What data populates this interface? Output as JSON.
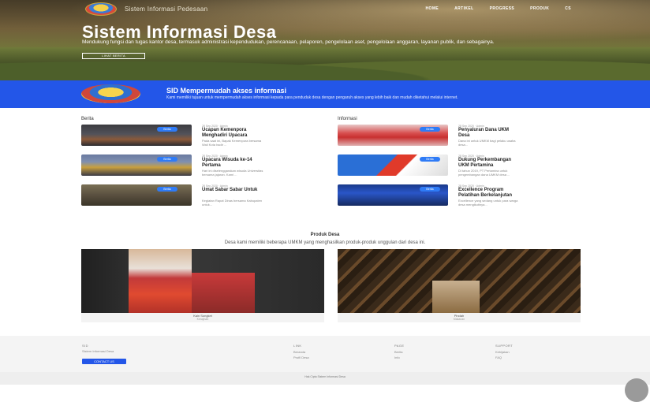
{
  "header": {
    "site_name": "Sistem Informasi Pedesaan",
    "nav": [
      "HOME",
      "ARTIKEL",
      "PROGRESS",
      "PRODUK",
      "CS"
    ]
  },
  "hero": {
    "title": "Sistem Informasi Desa",
    "description": "Mendukung fungsi dan tugas kantor desa, termasuk administrasi kependudukan, perencanaan, pelaporen, pengelolaan aset, pengelolaan anggaran, layanan publik, dan sebagainya.",
    "button": "LIHAT BERITA"
  },
  "band": {
    "title": "SID Mempermudah akses informasi",
    "description": "Kami memiliki tujuan untuk mempermudah akses informasi kepada para penduduk desa dengan pengaruh akses yang lebih baik dan mudah diketahui melalui internet."
  },
  "berita": {
    "heading": "Berita",
    "items": [
      {
        "badge": "Berita",
        "meta": "28 Sep 2020  ·  Admin",
        "title": "Ucapan Kemenpora Menghadiri Upacara",
        "excerpt": "Pada saat ini, Bapak Kemenpora bersama Wali Kota hadir ..."
      },
      {
        "badge": "Berita",
        "meta": "28 Sep 2020  ·  Admin",
        "title": "Upacara Wisuda ke-14 Pertama",
        "excerpt": "Hari ini diselenggarakan wisuda Universitas bersama jajaran. Kami ..."
      },
      {
        "badge": "Berita",
        "meta": "28 Sep 2020  ·  Admin",
        "title": "Umat Sabar Sabar Untuk",
        "excerpt": "Kegiatan Rapat Dinas bersama Kabupaten untuk..."
      }
    ]
  },
  "informasi": {
    "heading": "Informasi",
    "items": [
      {
        "badge": "Berita",
        "meta": "28 Sep 2020  ·  Admin",
        "title": "Penyaluran Dana UKM Desa",
        "excerpt": "Dana ini untuk UMKM bagi pelaku usaha desa..."
      },
      {
        "badge": "Berita",
        "meta": "28 Sep 2020  ·  Admin",
        "title": "Dukung Perkembangan UKM Pertamina",
        "excerpt": "Di tahun 2019, PT Pertamina untuk pengembangan dana UMKM desa ..."
      },
      {
        "badge": "Berita",
        "meta": "28 Sep 2020  ·  Admin",
        "title": "Excellence Program Pelatihan Berkelanjutan",
        "excerpt": "Excellence yang sedang untuk para warga desa mengikutinya..."
      }
    ]
  },
  "products": {
    "title": "Produk Desa",
    "subtitle": "Desa kami memiliki beberapa UMKM yang menghasilkan produk-produk unggulan dari desa ini.",
    "items": [
      {
        "name": "Kain Songket",
        "sub": "Kerajinan"
      },
      {
        "name": "Pindah",
        "sub": "Makanan"
      }
    ]
  },
  "footer": {
    "sid_head": "SID",
    "sid_text": "Sistem Informasi Desa",
    "contact_btn": "CONTACT US",
    "link_head": "LINK",
    "links": [
      "Beranda",
      "Profil Desa"
    ],
    "page_head": "PAGE",
    "pages": [
      "Berita",
      "Info"
    ],
    "support_head": "SUPPORT",
    "supports": [
      "Kebijakan",
      "FAQ"
    ],
    "copyright": "Hak Cipta Sistem Informasi Desa"
  }
}
